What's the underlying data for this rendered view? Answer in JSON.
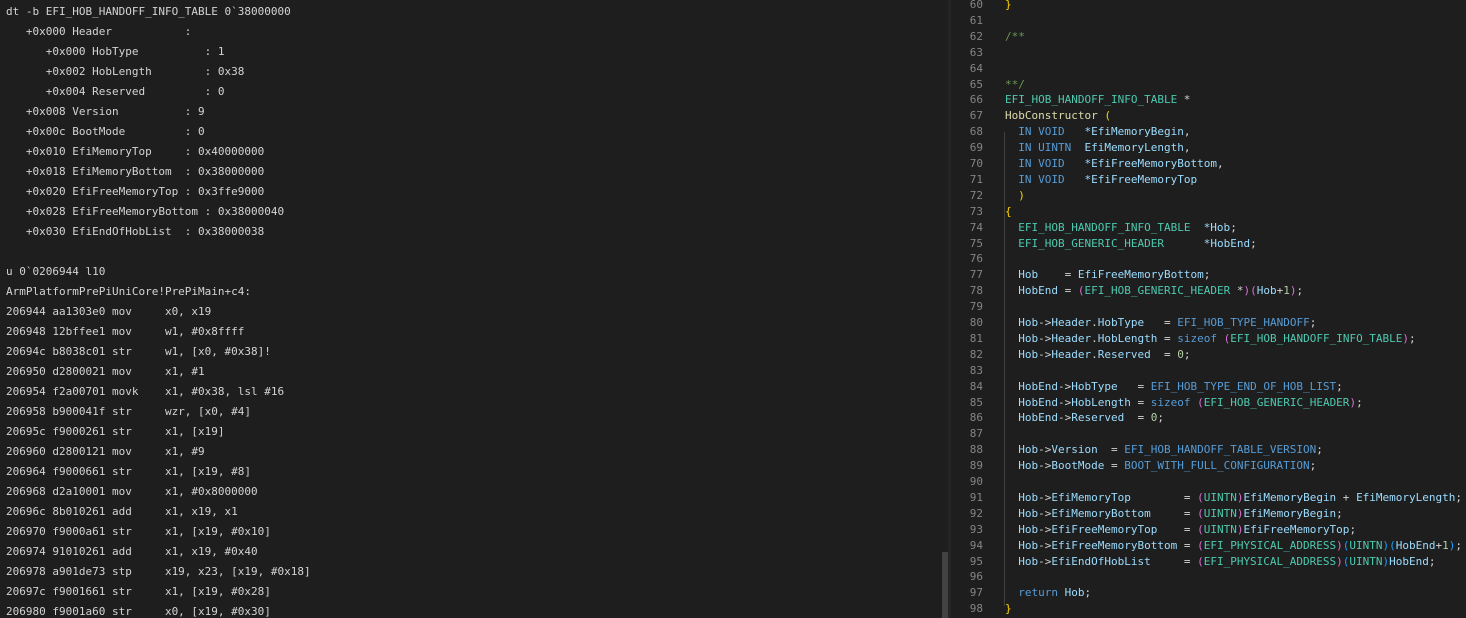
{
  "colors": {
    "background": "#1e1e1e",
    "debugger_text": "#d4d4d4",
    "line_number": "#858585",
    "keyword": "#569cd6",
    "type": "#4ec9b0",
    "variable": "#9cdcfe",
    "function": "#dcdcaa",
    "comment": "#6a9955",
    "brace": "#ffd700",
    "paren": "#da70d6",
    "paren_nested": "#179fff",
    "number": "#b5cea8"
  },
  "debugger": {
    "lines": [
      "dt -b EFI_HOB_HANDOFF_INFO_TABLE 0`38000000",
      "   +0x000 Header           :",
      "      +0x000 HobType          : 1",
      "      +0x002 HobLength        : 0x38",
      "      +0x004 Reserved         : 0",
      "   +0x008 Version          : 9",
      "   +0x00c BootMode         : 0",
      "   +0x010 EfiMemoryTop     : 0x40000000",
      "   +0x018 EfiMemoryBottom  : 0x38000000",
      "   +0x020 EfiFreeMemoryTop : 0x3ffe9000",
      "   +0x028 EfiFreeMemoryBottom : 0x38000040",
      "   +0x030 EfiEndOfHobList  : 0x38000038",
      "",
      "u 0`0206944 l10",
      "ArmPlatformPrePiUniCore!PrePiMain+c4:",
      "206944 aa1303e0 mov     x0, x19",
      "206948 12bffee1 mov     w1, #0x8ffff",
      "20694c b8038c01 str     w1, [x0, #0x38]!",
      "206950 d2800021 mov     x1, #1",
      "206954 f2a00701 movk    x1, #0x38, lsl #16",
      "206958 b900041f str     wzr, [x0, #4]",
      "20695c f9000261 str     x1, [x19]",
      "206960 d2800121 mov     x1, #9",
      "206964 f9000661 str     x1, [x19, #8]",
      "206968 d2a10001 mov     x1, #0x8000000",
      "20696c 8b010261 add     x1, x19, x1",
      "206970 f9000a61 str     x1, [x19, #0x10]",
      "206974 91010261 add     x1, x19, #0x40",
      "206978 a901de73 stp     x19, x23, [x19, #0x18]",
      "20697c f9001661 str     x1, [x19, #0x28]",
      "206980 f9001a60 str     x0, [x19, #0x30]"
    ]
  },
  "editor": {
    "lines": [
      {
        "n": "60",
        "tokens": [
          [
            "brace",
            "}"
          ]
        ]
      },
      {
        "n": "61",
        "tokens": []
      },
      {
        "n": "62",
        "tokens": [
          [
            "comment",
            "/**"
          ]
        ]
      },
      {
        "n": "63",
        "tokens": []
      },
      {
        "n": "64",
        "tokens": []
      },
      {
        "n": "65",
        "tokens": [
          [
            "comment",
            "**/"
          ]
        ]
      },
      {
        "n": "66",
        "tokens": [
          [
            "type",
            "EFI_HOB_HANDOFF_INFO_TABLE"
          ],
          [
            "default",
            " *"
          ]
        ]
      },
      {
        "n": "67",
        "tokens": [
          [
            "func",
            "HobConstructor"
          ],
          [
            "default",
            " "
          ],
          [
            "brace",
            "("
          ]
        ]
      },
      {
        "n": "68",
        "tokens": [
          [
            "default",
            "  "
          ],
          [
            "keyword",
            "IN"
          ],
          [
            "default",
            " "
          ],
          [
            "keyword",
            "VOID"
          ],
          [
            "default",
            "   "
          ],
          [
            "var",
            "*EfiMemoryBegin"
          ],
          [
            "default",
            ","
          ]
        ]
      },
      {
        "n": "69",
        "tokens": [
          [
            "default",
            "  "
          ],
          [
            "keyword",
            "IN"
          ],
          [
            "default",
            " "
          ],
          [
            "keyword",
            "UINTN"
          ],
          [
            "default",
            "  "
          ],
          [
            "var",
            "EfiMemoryLength"
          ],
          [
            "default",
            ","
          ]
        ]
      },
      {
        "n": "70",
        "tokens": [
          [
            "default",
            "  "
          ],
          [
            "keyword",
            "IN"
          ],
          [
            "default",
            " "
          ],
          [
            "keyword",
            "VOID"
          ],
          [
            "default",
            "   "
          ],
          [
            "var",
            "*EfiFreeMemoryBottom"
          ],
          [
            "default",
            ","
          ]
        ]
      },
      {
        "n": "71",
        "tokens": [
          [
            "default",
            "  "
          ],
          [
            "keyword",
            "IN"
          ],
          [
            "default",
            " "
          ],
          [
            "keyword",
            "VOID"
          ],
          [
            "default",
            "   "
          ],
          [
            "var",
            "*EfiFreeMemoryTop"
          ]
        ]
      },
      {
        "n": "72",
        "tokens": [
          [
            "default",
            "  "
          ],
          [
            "brace",
            ")"
          ]
        ]
      },
      {
        "n": "73",
        "tokens": [
          [
            "brace",
            "{"
          ]
        ]
      },
      {
        "n": "74",
        "tokens": [
          [
            "default",
            "  "
          ],
          [
            "type",
            "EFI_HOB_HANDOFF_INFO_TABLE"
          ],
          [
            "default",
            "  "
          ],
          [
            "var",
            "*Hob"
          ],
          [
            "default",
            ";"
          ]
        ]
      },
      {
        "n": "75",
        "tokens": [
          [
            "default",
            "  "
          ],
          [
            "type",
            "EFI_HOB_GENERIC_HEADER"
          ],
          [
            "default",
            "      "
          ],
          [
            "var",
            "*HobEnd"
          ],
          [
            "default",
            ";"
          ]
        ]
      },
      {
        "n": "76",
        "tokens": []
      },
      {
        "n": "77",
        "tokens": [
          [
            "default",
            "  "
          ],
          [
            "var",
            "Hob"
          ],
          [
            "default",
            "    = "
          ],
          [
            "var",
            "EfiFreeMemoryBottom"
          ],
          [
            "default",
            ";"
          ]
        ]
      },
      {
        "n": "78",
        "tokens": [
          [
            "default",
            "  "
          ],
          [
            "var",
            "HobEnd"
          ],
          [
            "default",
            " = "
          ],
          [
            "paren",
            "("
          ],
          [
            "type",
            "EFI_HOB_GENERIC_HEADER"
          ],
          [
            "default",
            " *"
          ],
          [
            "paren",
            ")"
          ],
          [
            "paren",
            "("
          ],
          [
            "var",
            "Hob"
          ],
          [
            "default",
            "+"
          ],
          [
            "num",
            "1"
          ],
          [
            "paren",
            ")"
          ],
          [
            "default",
            ";"
          ]
        ]
      },
      {
        "n": "79",
        "tokens": []
      },
      {
        "n": "80",
        "tokens": [
          [
            "default",
            "  "
          ],
          [
            "var",
            "Hob"
          ],
          [
            "default",
            "->"
          ],
          [
            "var",
            "Header"
          ],
          [
            "default",
            "."
          ],
          [
            "var",
            "HobType"
          ],
          [
            "default",
            "   = "
          ],
          [
            "keyword",
            "EFI_HOB_TYPE_HANDOFF"
          ],
          [
            "default",
            ";"
          ]
        ]
      },
      {
        "n": "81",
        "tokens": [
          [
            "default",
            "  "
          ],
          [
            "var",
            "Hob"
          ],
          [
            "default",
            "->"
          ],
          [
            "var",
            "Header"
          ],
          [
            "default",
            "."
          ],
          [
            "var",
            "HobLength"
          ],
          [
            "default",
            " = "
          ],
          [
            "keyword",
            "sizeof"
          ],
          [
            "default",
            " "
          ],
          [
            "paren",
            "("
          ],
          [
            "type",
            "EFI_HOB_HANDOFF_INFO_TABLE"
          ],
          [
            "paren",
            ")"
          ],
          [
            "default",
            ";"
          ]
        ]
      },
      {
        "n": "82",
        "tokens": [
          [
            "default",
            "  "
          ],
          [
            "var",
            "Hob"
          ],
          [
            "default",
            "->"
          ],
          [
            "var",
            "Header"
          ],
          [
            "default",
            "."
          ],
          [
            "var",
            "Reserved"
          ],
          [
            "default",
            "  = "
          ],
          [
            "num",
            "0"
          ],
          [
            "default",
            ";"
          ]
        ]
      },
      {
        "n": "83",
        "tokens": []
      },
      {
        "n": "84",
        "tokens": [
          [
            "default",
            "  "
          ],
          [
            "var",
            "HobEnd"
          ],
          [
            "default",
            "->"
          ],
          [
            "var",
            "HobType"
          ],
          [
            "default",
            "   = "
          ],
          [
            "keyword",
            "EFI_HOB_TYPE_END_OF_HOB_LIST"
          ],
          [
            "default",
            ";"
          ]
        ]
      },
      {
        "n": "85",
        "tokens": [
          [
            "default",
            "  "
          ],
          [
            "var",
            "HobEnd"
          ],
          [
            "default",
            "->"
          ],
          [
            "var",
            "HobLength"
          ],
          [
            "default",
            " = "
          ],
          [
            "keyword",
            "sizeof"
          ],
          [
            "default",
            " "
          ],
          [
            "paren",
            "("
          ],
          [
            "type",
            "EFI_HOB_GENERIC_HEADER"
          ],
          [
            "paren",
            ")"
          ],
          [
            "default",
            ";"
          ]
        ]
      },
      {
        "n": "86",
        "tokens": [
          [
            "default",
            "  "
          ],
          [
            "var",
            "HobEnd"
          ],
          [
            "default",
            "->"
          ],
          [
            "var",
            "Reserved"
          ],
          [
            "default",
            "  = "
          ],
          [
            "num",
            "0"
          ],
          [
            "default",
            ";"
          ]
        ]
      },
      {
        "n": "87",
        "tokens": []
      },
      {
        "n": "88",
        "tokens": [
          [
            "default",
            "  "
          ],
          [
            "var",
            "Hob"
          ],
          [
            "default",
            "->"
          ],
          [
            "var",
            "Version"
          ],
          [
            "default",
            "  = "
          ],
          [
            "keyword",
            "EFI_HOB_HANDOFF_TABLE_VERSION"
          ],
          [
            "default",
            ";"
          ]
        ]
      },
      {
        "n": "89",
        "tokens": [
          [
            "default",
            "  "
          ],
          [
            "var",
            "Hob"
          ],
          [
            "default",
            "->"
          ],
          [
            "var",
            "BootMode"
          ],
          [
            "default",
            " = "
          ],
          [
            "keyword",
            "BOOT_WITH_FULL_CONFIGURATION"
          ],
          [
            "default",
            ";"
          ]
        ]
      },
      {
        "n": "90",
        "tokens": []
      },
      {
        "n": "91",
        "tokens": [
          [
            "default",
            "  "
          ],
          [
            "var",
            "Hob"
          ],
          [
            "default",
            "->"
          ],
          [
            "var",
            "EfiMemoryTop"
          ],
          [
            "default",
            "        = "
          ],
          [
            "paren",
            "("
          ],
          [
            "type",
            "UINTN"
          ],
          [
            "paren",
            ")"
          ],
          [
            "var",
            "EfiMemoryBegin"
          ],
          [
            "default",
            " + "
          ],
          [
            "var",
            "EfiMemoryLength"
          ],
          [
            "default",
            ";"
          ]
        ]
      },
      {
        "n": "92",
        "tokens": [
          [
            "default",
            "  "
          ],
          [
            "var",
            "Hob"
          ],
          [
            "default",
            "->"
          ],
          [
            "var",
            "EfiMemoryBottom"
          ],
          [
            "default",
            "     = "
          ],
          [
            "paren",
            "("
          ],
          [
            "type",
            "UINTN"
          ],
          [
            "paren",
            ")"
          ],
          [
            "var",
            "EfiMemoryBegin"
          ],
          [
            "default",
            ";"
          ]
        ]
      },
      {
        "n": "93",
        "tokens": [
          [
            "default",
            "  "
          ],
          [
            "var",
            "Hob"
          ],
          [
            "default",
            "->"
          ],
          [
            "var",
            "EfiFreeMemoryTop"
          ],
          [
            "default",
            "    = "
          ],
          [
            "paren",
            "("
          ],
          [
            "type",
            "UINTN"
          ],
          [
            "paren",
            ")"
          ],
          [
            "var",
            "EfiFreeMemoryTop"
          ],
          [
            "default",
            ";"
          ]
        ]
      },
      {
        "n": "94",
        "tokens": [
          [
            "default",
            "  "
          ],
          [
            "var",
            "Hob"
          ],
          [
            "default",
            "->"
          ],
          [
            "var",
            "EfiFreeMemoryBottom"
          ],
          [
            "default",
            " = "
          ],
          [
            "paren",
            "("
          ],
          [
            "type",
            "EFI_PHYSICAL_ADDRESS"
          ],
          [
            "paren",
            ")"
          ],
          [
            "paren2",
            "("
          ],
          [
            "type",
            "UINTN"
          ],
          [
            "paren2",
            ")"
          ],
          [
            "paren2",
            "("
          ],
          [
            "var",
            "HobEnd"
          ],
          [
            "default",
            "+"
          ],
          [
            "num",
            "1"
          ],
          [
            "paren2",
            ")"
          ],
          [
            "default",
            ";"
          ]
        ]
      },
      {
        "n": "95",
        "tokens": [
          [
            "default",
            "  "
          ],
          [
            "var",
            "Hob"
          ],
          [
            "default",
            "->"
          ],
          [
            "var",
            "EfiEndOfHobList"
          ],
          [
            "default",
            "     = "
          ],
          [
            "paren",
            "("
          ],
          [
            "type",
            "EFI_PHYSICAL_ADDRESS"
          ],
          [
            "paren",
            ")"
          ],
          [
            "paren2",
            "("
          ],
          [
            "type",
            "UINTN"
          ],
          [
            "paren2",
            ")"
          ],
          [
            "var",
            "HobEnd"
          ],
          [
            "default",
            ";"
          ]
        ]
      },
      {
        "n": "96",
        "tokens": []
      },
      {
        "n": "97",
        "tokens": [
          [
            "default",
            "  "
          ],
          [
            "keyword",
            "return"
          ],
          [
            "default",
            " "
          ],
          [
            "var",
            "Hob"
          ],
          [
            "default",
            ";"
          ]
        ]
      },
      {
        "n": "98",
        "tokens": [
          [
            "brace",
            "}"
          ]
        ]
      }
    ]
  }
}
